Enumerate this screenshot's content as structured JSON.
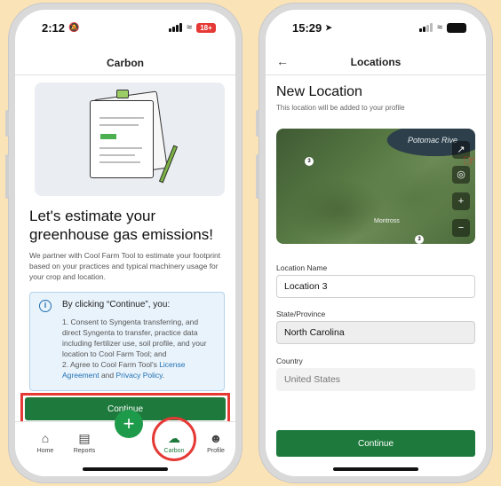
{
  "left_screen": {
    "status": {
      "time": "2:12",
      "battery": "18+"
    },
    "header": {
      "title": "Carbon"
    },
    "headline": "Let's estimate your greenhouse gas emissions!",
    "description": "We partner with Cool Farm Tool to estimate your footprint based on your practices and typical machinery usage for your crop and location.",
    "info": {
      "title": "By clicking “Continue”, you:",
      "item1": "1. Consent to Syngenta transferring, and direct Syngenta to transfer, practice data including fertilizer use, soil profile, and your location to Cool Farm Tool; and",
      "item2_prefix": "2. Agree to Cool Farm Tool's ",
      "license_link": "License Agreement",
      "and_text": " and ",
      "privacy_link": "Privacy Policy",
      "end_text": "."
    },
    "continue_label": "Continue",
    "tabs": [
      {
        "label": "Home",
        "icon": "home-icon"
      },
      {
        "label": "Reports",
        "icon": "reports-icon"
      },
      {
        "label": "+",
        "icon": "plus-icon"
      },
      {
        "label": "Carbon",
        "icon": "cloud-icon"
      },
      {
        "label": "Profile",
        "icon": "profile-icon"
      }
    ],
    "accent": "#1e7a3c",
    "highlight": "#e53935"
  },
  "right_screen": {
    "status": {
      "time": "15:29"
    },
    "header": {
      "title": "Locations"
    },
    "new_location_title": "New Location",
    "new_location_subtitle": "This location will be added to your profile",
    "map": {
      "river_label": "Potomac Rive",
      "town_label": "Montross",
      "road_labels": [
        "3",
        "3"
      ],
      "controls": [
        "expand-icon",
        "locate-icon",
        "zoom-in-icon",
        "zoom-out-icon"
      ],
      "zoom_in": "+",
      "zoom_out": "−"
    },
    "fields": {
      "location_name_label": "Location Name",
      "location_name_value": "Location 3",
      "state_label": "State/Province",
      "state_value": "North Carolina",
      "country_label": "Country",
      "country_value": "United States"
    },
    "continue_label": "Continue"
  }
}
